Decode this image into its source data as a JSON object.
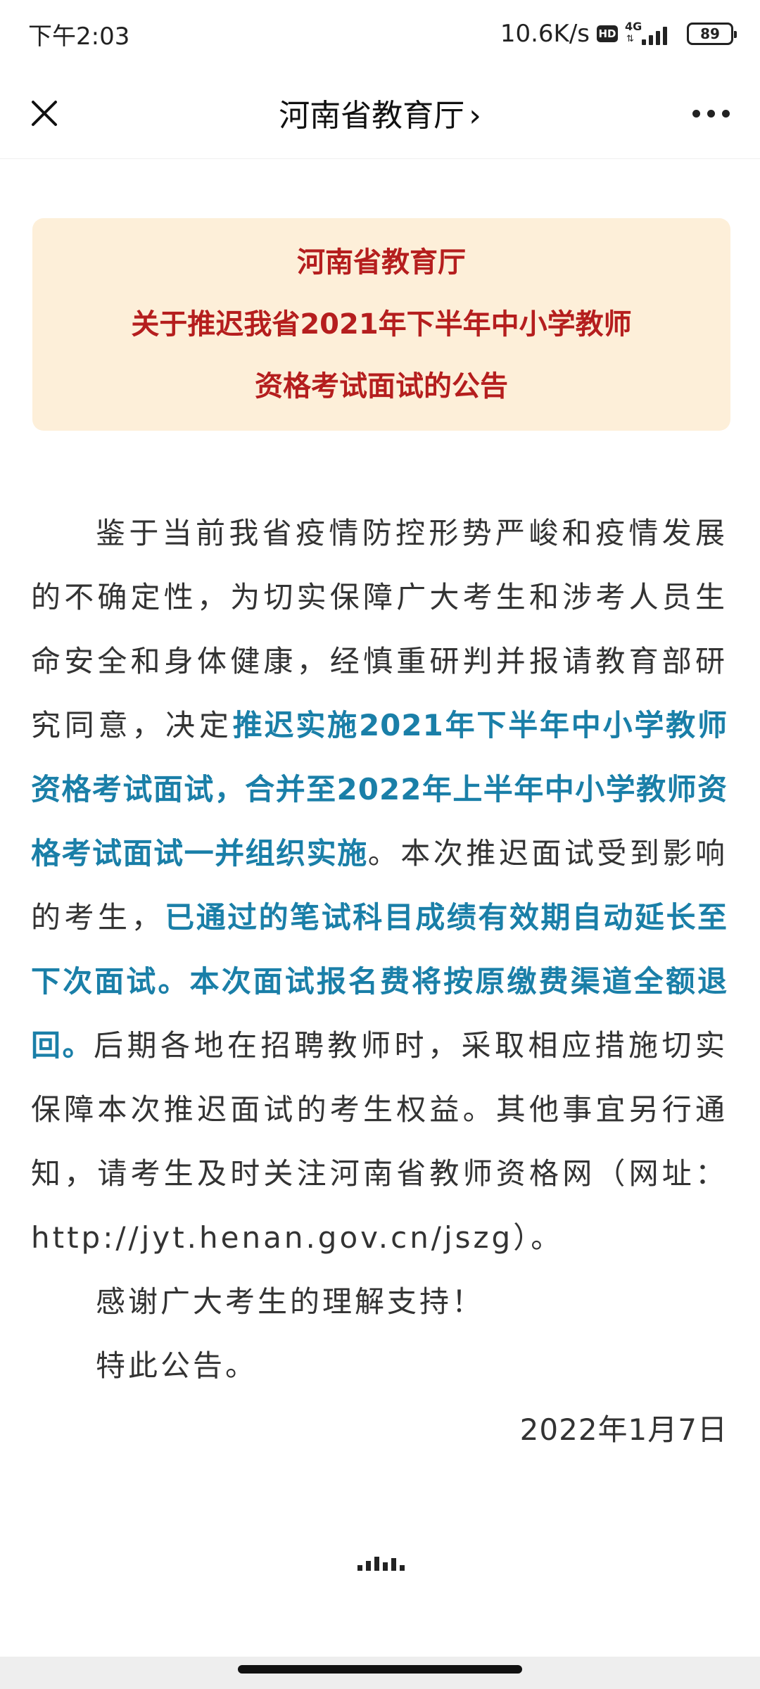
{
  "status_bar": {
    "time": "下午2:03",
    "net_speed": "10.6K/s",
    "hd": "HD",
    "network": "4G",
    "battery": "89"
  },
  "nav": {
    "title": "河南省教育厅",
    "chevron": "›",
    "close_icon": "close-icon",
    "more_icon": "more-icon"
  },
  "notice": {
    "line1": "河南省教育厅",
    "line2": "关于推迟我省2021年下半年中小学教师",
    "line3": "资格考试面试的公告"
  },
  "article": {
    "p1_a": "鉴于当前我省疫情防控形势严峻和疫情发展的不确定性，为切实保障广大考生和涉考人员生命安全和身体健康，经慎重研判并报请教育部研究同意，决定",
    "p1_h1": "推迟实施2021年下半年中小学教师资格考试面试，合并至2022年上半年中小学教师资格考试面试一并组织实施",
    "p1_b": "。本次推迟面试受到影响的考生，",
    "p1_h2": "已通过的笔试科目成绩有效期自动延长至下次面试。本次面试报名费将按原缴费渠道全额退回。",
    "p1_c": "后期各地在招聘教师时，采取相应措施切实保障本次推迟面试的考生权益。其他事宜另行通知，请考生及时关注河南省教师资格网（网址：http://jyt.henan.gov.cn/jszg）。",
    "p2": "感谢广大考生的理解支持！",
    "p3": "特此公告。",
    "date": "2022年1月7日"
  },
  "colors": {
    "card_bg": "#fdefd9",
    "card_text": "#b51e1e",
    "highlight": "#1a7fa8"
  }
}
